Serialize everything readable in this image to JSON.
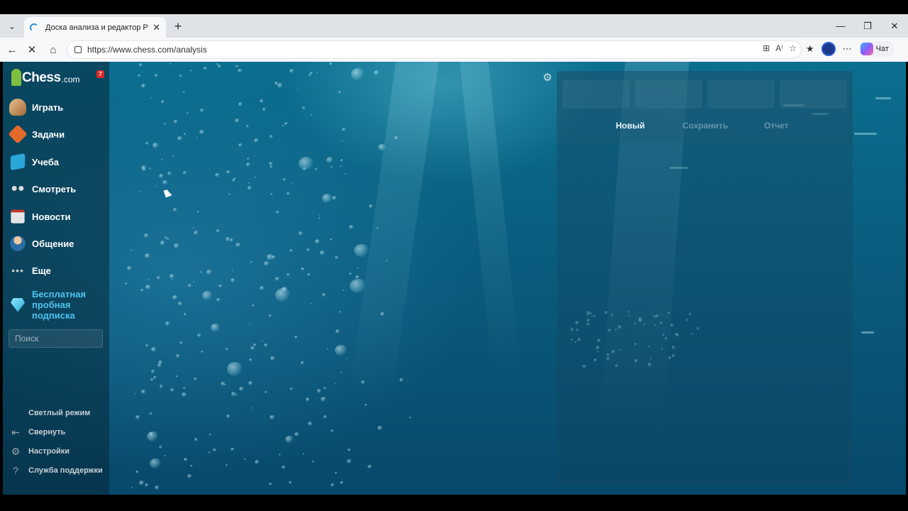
{
  "browser": {
    "tab_title": "Доска анализа и редактор PGN",
    "url": "https://www.chess.com/analysis",
    "copilot_label": "Чат"
  },
  "sidebar": {
    "logo_main": "Chess",
    "logo_sub": ".com",
    "notification_count": "7",
    "items": [
      {
        "label": "Играть",
        "icon": "pawn-icon"
      },
      {
        "label": "Задачи",
        "icon": "puzzle-icon"
      },
      {
        "label": "Учеба",
        "icon": "learn-icon"
      },
      {
        "label": "Смотреть",
        "icon": "binoculars-icon"
      },
      {
        "label": "Новости",
        "icon": "news-icon"
      },
      {
        "label": "Общение",
        "icon": "social-icon"
      },
      {
        "label": "Еще",
        "icon": "more-icon"
      }
    ],
    "trial_label": "Бесплатная пробная подписка",
    "search_placeholder": "Поиск",
    "light_mode": "Светлый режим",
    "collapse": "Свернуть",
    "settings": "Настройки",
    "support": "Служба поддержки"
  },
  "panel": {
    "tabs": [
      {
        "label": "Новый",
        "active": true
      },
      {
        "label": "Сохранить",
        "active": false
      },
      {
        "label": "Отчет",
        "active": false
      }
    ]
  }
}
